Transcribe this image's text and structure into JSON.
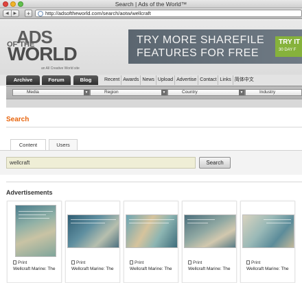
{
  "browser": {
    "window_title": "Search | Ads of the World™",
    "back_label": "◀",
    "forward_label": "▶",
    "new_tab_label": "+",
    "url": "http://adsoftheworld.com/search/aotw/wellcraft"
  },
  "logo": {
    "line1": "ADS",
    "line2": "OF THE",
    "line3": "WORLD",
    "tagline": "an All Creative World site"
  },
  "banner": {
    "line1": "TRY MORE SHAREFILE",
    "line2": "FEATURES FOR FREE",
    "cta_line1": "TRY IT",
    "cta_line2": "30 DAY F"
  },
  "nav": {
    "tabs": [
      "Archive",
      "Forum",
      "Blog"
    ],
    "links": [
      "Recent",
      "Awards",
      "News",
      "Upload",
      "Advertise",
      "Contact",
      "Links",
      "简体中文"
    ]
  },
  "filters": [
    "Media",
    "Region",
    "Country",
    "Industry"
  ],
  "search": {
    "heading": "Search",
    "tabs": [
      "Content",
      "Users"
    ],
    "query": "wellcraft",
    "button_label": "Search"
  },
  "ads": {
    "heading": "Advertisements",
    "items": [
      {
        "media": "Print",
        "title": "Wellcraft Marine: The"
      },
      {
        "media": "Print",
        "title": "Wellcraft Marine: The"
      },
      {
        "media": "Print",
        "title": "Wellcraft Marine: The"
      },
      {
        "media": "Print",
        "title": "Wellcraft Marine: The"
      },
      {
        "media": "Print",
        "title": "Wellcraft Marine: The"
      }
    ]
  },
  "colors": {
    "accent_orange": "#e8640c",
    "search_field_bg": "#efeed6",
    "banner_cta_green": "#86b23b"
  }
}
